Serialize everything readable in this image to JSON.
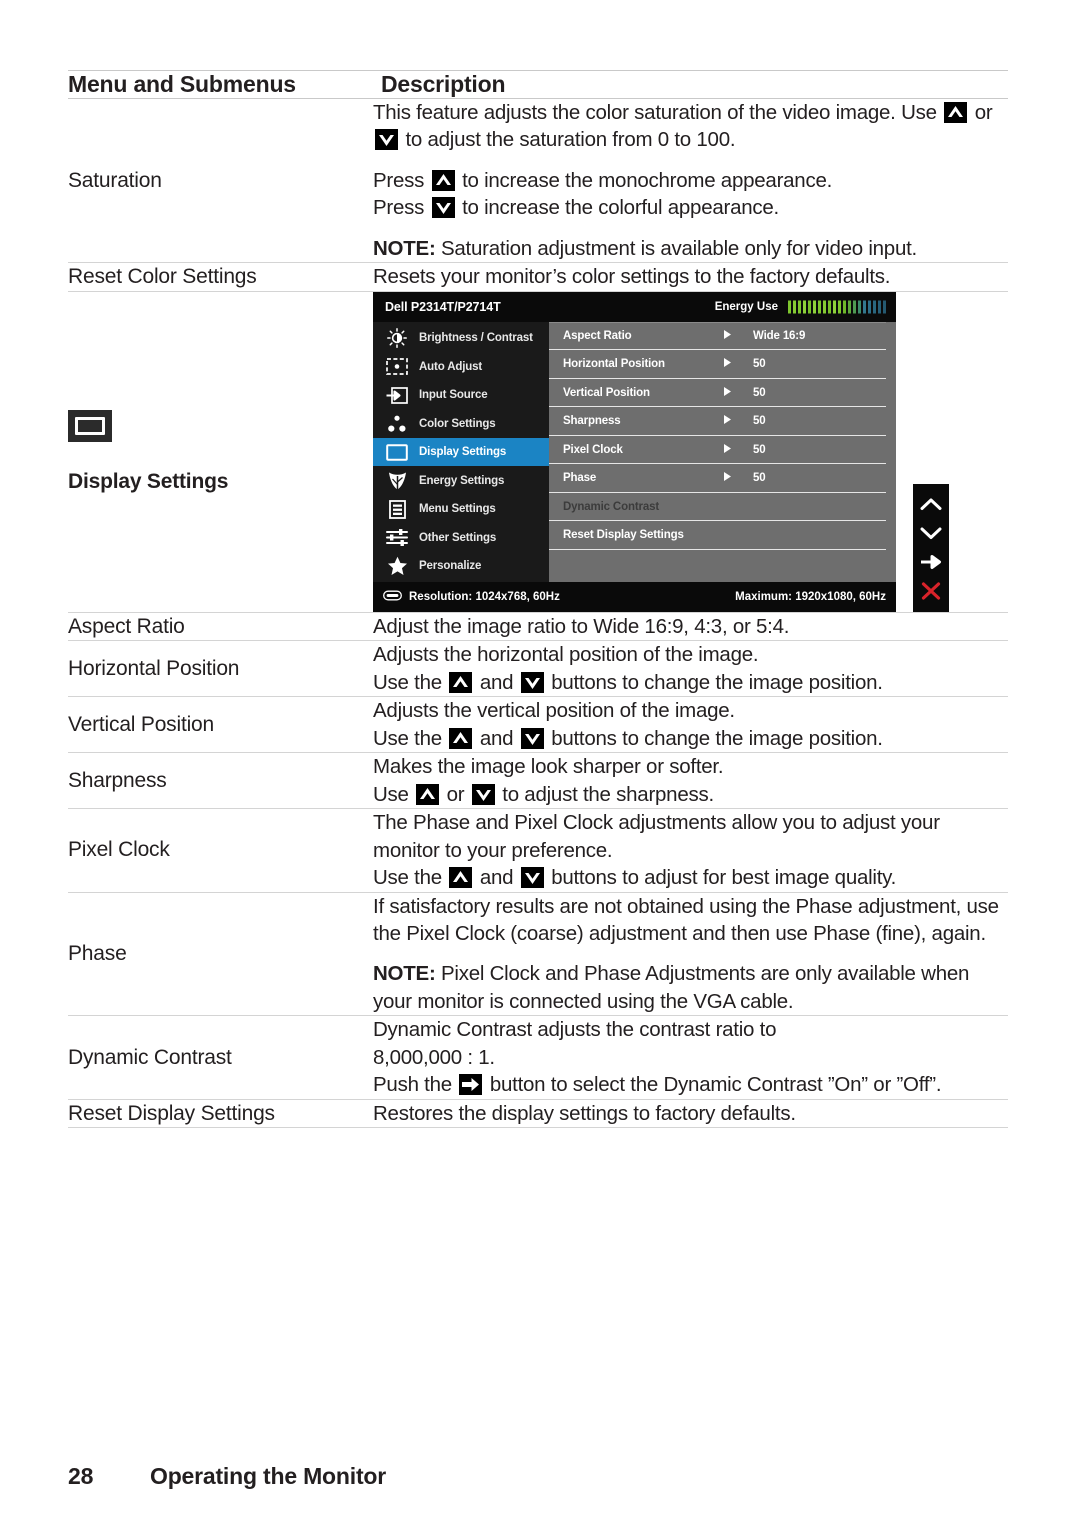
{
  "table": {
    "headers": {
      "col1": "Menu and Submenus",
      "col2": "Description"
    },
    "rows": [
      {
        "name": "Saturation",
        "bold": false,
        "paragraphs": [
          "This feature adjusts the color saturation of the video image. Use [UP] or [DOWN] to adjust the saturation from 0 to 100.",
          "Press [UP] to increase the monochrome appearance. Press [DOWN] to increase the colorful appearance.",
          "NOTE: Saturation adjustment is available only for video input."
        ],
        "p1_a": "This feature adjusts the color saturation of the video image.",
        "p1_b": "Use",
        "p1_c": "or",
        "p1_d": "to adjust the saturation from 0 to 100.",
        "p2_a": "Press",
        "p2_b": "to increase the monochrome appearance.",
        "p2_c": "Press",
        "p2_d": "to increase the colorful appearance.",
        "p3_note": "NOTE:",
        "p3_text": "Saturation adjustment is available only for video input."
      },
      {
        "name": "Reset Color Settings",
        "description": "Resets your monitor’s color settings to the factory defaults."
      },
      {
        "name": "Display Settings",
        "icon": "monitor-icon"
      },
      {
        "name": "Aspect Ratio",
        "description": "Adjust the image ratio to Wide 16:9, 4:3, or 5:4."
      },
      {
        "name": "Horizontal Position",
        "line1": "Adjusts the horizontal position of the image.",
        "line2_a": "Use the",
        "line2_b": "and",
        "line2_c": "buttons to change the image position."
      },
      {
        "name": "Vertical Position",
        "line1": "Adjusts the vertical position of the image.",
        "line2_a": "Use the",
        "line2_b": "and",
        "line2_c": "buttons to change the image position."
      },
      {
        "name": "Sharpness",
        "line1": "Makes the image look sharper or softer.",
        "line2_a": "Use",
        "line2_b": "or",
        "line2_c": "to adjust the sharpness."
      },
      {
        "name": "Pixel Clock",
        "line1": "The Phase and Pixel Clock adjustments allow you to adjust your monitor to your preference.",
        "line2_a": "Use the",
        "line2_b": "and",
        "line2_c": "buttons to adjust for best image quality."
      },
      {
        "name": "Phase",
        "p1": "If satisfactory results are not obtained using the Phase adjustment, use the Pixel Clock (coarse) adjustment and then use Phase (fine), again.",
        "p2_note": "NOTE:",
        "p2_text": "Pixel Clock and Phase Adjustments are only available when your monitor is connected using the VGA cable."
      },
      {
        "name": "Dynamic Contrast",
        "line1": "Dynamic Contrast adjusts the contrast ratio to",
        "line2": "8,000,000 : 1.",
        "line3_a": "Push the",
        "line3_b": "button to select the Dynamic Contrast ”On” or ”Off”."
      },
      {
        "name": "Reset Display Settings",
        "description": "Restores the display settings to factory defaults."
      }
    ]
  },
  "osd": {
    "model": "Dell P2314T/P2714T",
    "energy_label": "Energy Use",
    "energy_bars": 20,
    "menu_items": [
      {
        "label": "Brightness / Contrast",
        "icon": "brightness-icon",
        "active": false
      },
      {
        "label": "Auto Adjust",
        "icon": "auto-adjust-icon",
        "active": false
      },
      {
        "label": "Input Source",
        "icon": "input-source-icon",
        "active": false
      },
      {
        "label": "Color Settings",
        "icon": "color-settings-icon",
        "active": false
      },
      {
        "label": "Display Settings",
        "icon": "display-settings-icon",
        "active": true
      },
      {
        "label": "Energy Settings",
        "icon": "energy-leaf-icon",
        "active": false
      },
      {
        "label": "Menu Settings",
        "icon": "menu-settings-icon",
        "active": false
      },
      {
        "label": "Other Settings",
        "icon": "other-settings-icon",
        "active": false
      },
      {
        "label": "Personalize",
        "icon": "star-icon",
        "active": false
      }
    ],
    "settings_rows": [
      {
        "label": "Aspect Ratio",
        "arrow": true,
        "value": "Wide 16:9",
        "dim": false
      },
      {
        "label": "Horizontal Position",
        "arrow": true,
        "value": "50",
        "dim": false
      },
      {
        "label": "Vertical Position",
        "arrow": true,
        "value": "50",
        "dim": false
      },
      {
        "label": "Sharpness",
        "arrow": true,
        "value": "50",
        "dim": false
      },
      {
        "label": "Pixel Clock",
        "arrow": true,
        "value": "50",
        "dim": false
      },
      {
        "label": "Phase",
        "arrow": true,
        "value": "50",
        "dim": false
      },
      {
        "label": "Dynamic Contrast",
        "arrow": false,
        "value": "",
        "dim": true
      },
      {
        "label": "Reset Display Settings",
        "arrow": false,
        "value": "",
        "dim": false
      },
      {
        "label": "",
        "arrow": false,
        "value": "",
        "dim": false
      }
    ],
    "resolution": "Resolution:  1024x768, 60Hz",
    "maximum": "Maximum: 1920x1080, 60Hz",
    "buttons": [
      {
        "name": "up-chevron-icon",
        "color": "#ffffff"
      },
      {
        "name": "down-chevron-icon",
        "color": "#ffffff"
      },
      {
        "name": "right-arrow-icon",
        "color": "#ffffff"
      },
      {
        "name": "close-x-icon",
        "color": "#d8232a"
      }
    ],
    "colors": {
      "header_bg": "#0a0a0a",
      "panel_bg": "#6e6e6e",
      "sidebar_bg": "#1a1a1a",
      "highlight": "#1b84c4",
      "energy_green": "#72c02c",
      "energy_teal": "#2b7a91",
      "close_red": "#d8232a"
    }
  },
  "footer": {
    "page_number": "28",
    "section_title": "Operating the Monitor"
  }
}
